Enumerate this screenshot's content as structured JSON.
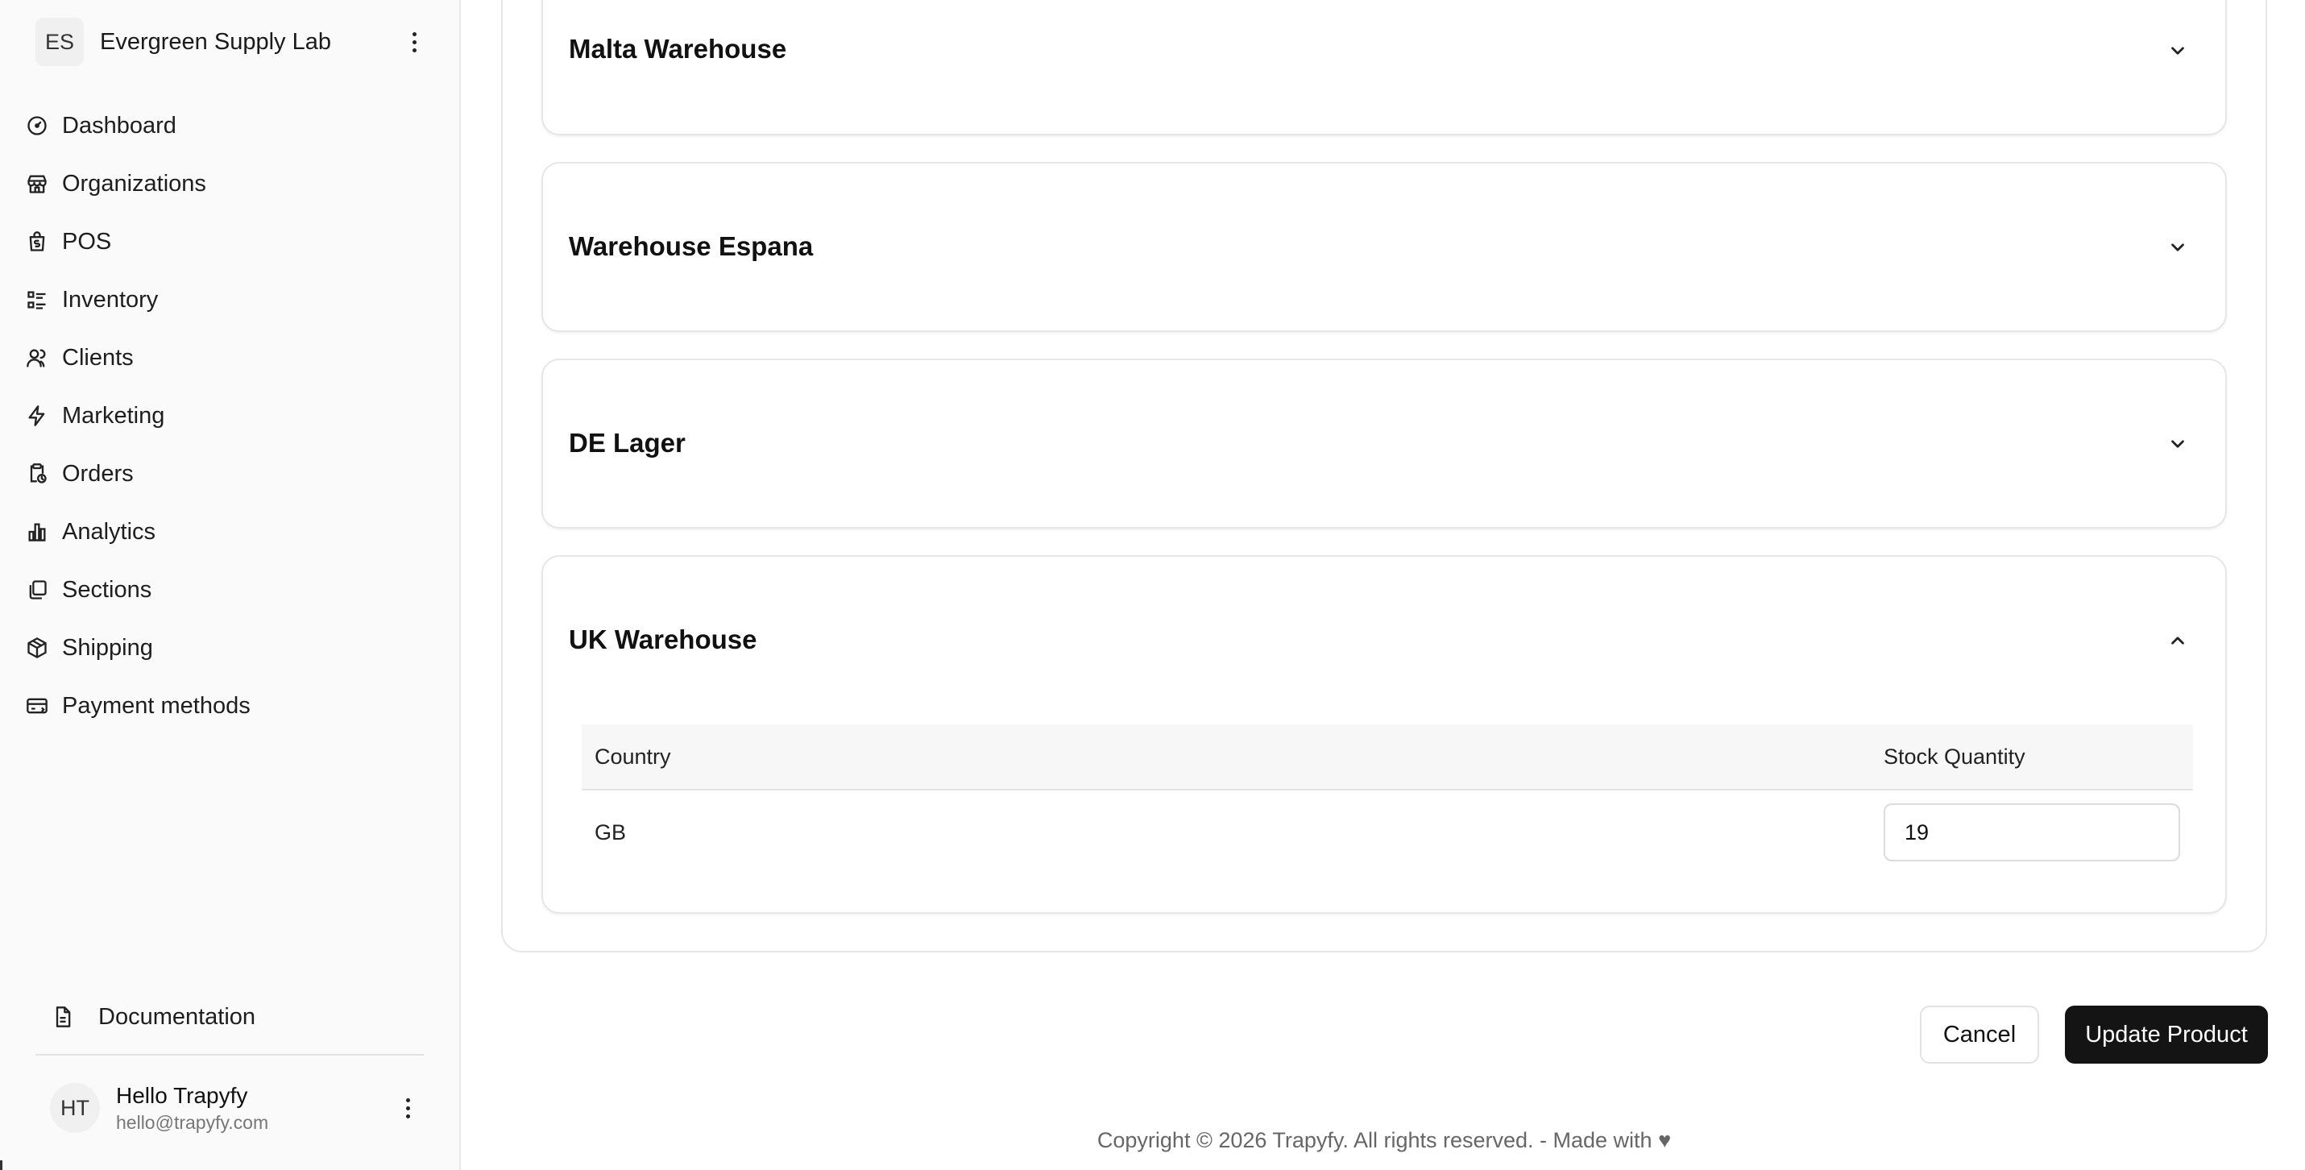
{
  "org": {
    "initials": "ES",
    "name": "Evergreen Supply Lab"
  },
  "nav": {
    "items": [
      {
        "label": "Dashboard",
        "icon": "gauge-icon"
      },
      {
        "label": "Organizations",
        "icon": "store-icon"
      },
      {
        "label": "POS",
        "icon": "shopping-bag-dollar-icon"
      },
      {
        "label": "Inventory",
        "icon": "list-checks-icon"
      },
      {
        "label": "Clients",
        "icon": "users-icon"
      },
      {
        "label": "Marketing",
        "icon": "zap-icon"
      },
      {
        "label": "Orders",
        "icon": "clipboard-clock-icon"
      },
      {
        "label": "Analytics",
        "icon": "bar-chart-icon"
      },
      {
        "label": "Sections",
        "icon": "copy-icon"
      },
      {
        "label": "Shipping",
        "icon": "package-icon"
      },
      {
        "label": "Payment methods",
        "icon": "credit-card-icon"
      }
    ],
    "documentation": "Documentation"
  },
  "user": {
    "initials": "HT",
    "name": "Hello Trapyfy",
    "email": "hello@trapyfy.com"
  },
  "warehouses": [
    {
      "name": "Malta Warehouse",
      "expanded": false
    },
    {
      "name": "Warehouse Espana",
      "expanded": false
    },
    {
      "name": "DE Lager",
      "expanded": false
    },
    {
      "name": "UK Warehouse",
      "expanded": true
    }
  ],
  "stock_table": {
    "headers": {
      "country": "Country",
      "quantity": "Stock Quantity"
    },
    "rows": [
      {
        "country": "GB",
        "quantity": "19"
      }
    ]
  },
  "actions": {
    "cancel": "Cancel",
    "update": "Update Product"
  },
  "footer": "Copyright © 2026 Trapyfy. All rights reserved. - Made with ♥"
}
